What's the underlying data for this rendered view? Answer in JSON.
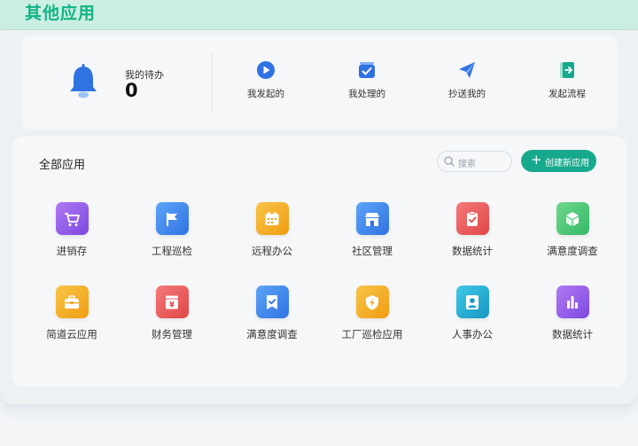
{
  "header": {
    "title": "其他应用"
  },
  "todo": {
    "label": "我的待办",
    "count": "0"
  },
  "quick_actions": [
    {
      "label": "我发起的",
      "icon": "play-circle-icon"
    },
    {
      "label": "我处理的",
      "icon": "check-box-icon"
    },
    {
      "label": "抄送我的",
      "icon": "paper-plane-icon"
    },
    {
      "label": "发起流程",
      "icon": "exit-door-icon"
    }
  ],
  "apps_section": {
    "title": "全部应用",
    "search_placeholder": "搜索",
    "create_label": "创建新应用"
  },
  "apps": [
    {
      "label": "进销存",
      "icon": "cart-icon",
      "color": "#8b5cf6"
    },
    {
      "label": "工程巡检",
      "icon": "flag-icon",
      "color": "#3b82f6"
    },
    {
      "label": "远程办公",
      "icon": "calendar-icon",
      "color": "#f5a623"
    },
    {
      "label": "社区管理",
      "icon": "store-icon",
      "color": "#3b82f6"
    },
    {
      "label": "数据统计",
      "icon": "clipboard-check-icon",
      "color": "#ef5350"
    },
    {
      "label": "满意度调查",
      "icon": "cube-icon",
      "color": "#43c06f"
    },
    {
      "label": "简道云应用",
      "icon": "briefcase-icon",
      "color": "#f5a623"
    },
    {
      "label": "财务管理",
      "icon": "finance-icon",
      "color": "#ef5350"
    },
    {
      "label": "满意度调查",
      "icon": "bookmark-check-icon",
      "color": "#3b82f6"
    },
    {
      "label": "工厂巡检应用",
      "icon": "shield-bolt-icon",
      "color": "#f5a623"
    },
    {
      "label": "人事办公",
      "icon": "person-badge-icon",
      "color": "#1ea7d6"
    },
    {
      "label": "数据统计",
      "icon": "bar-chart-icon",
      "color": "#8b5cf6"
    }
  ]
}
